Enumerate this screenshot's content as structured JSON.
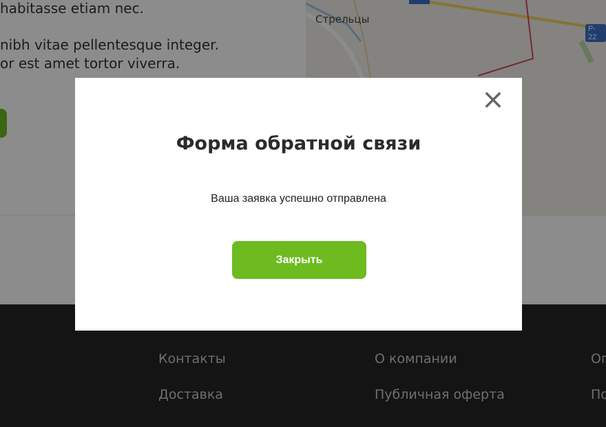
{
  "background": {
    "text_lines": [
      "habitasse etiam nec.",
      "nibh vitae pellentesque integer.",
      "or est amet tortor viverra."
    ],
    "map": {
      "city_label": "Стрельцы",
      "road_badge": "P-22"
    }
  },
  "footer": {
    "links_col1": [
      "Контакты",
      "Доставка"
    ],
    "links_col2": [
      "О компании",
      "Публичная оферта"
    ],
    "links_col3": [
      "Оп",
      "По"
    ]
  },
  "modal": {
    "title": "Форма обратной связи",
    "message": "Ваша заявка успешно отправлена",
    "button_label": "Закрыть",
    "close_icon": "close-icon"
  },
  "colors": {
    "accent_green": "#6dbb1f",
    "footer_bg": "#252525",
    "overlay": "rgba(0,0,0,0.45)"
  }
}
